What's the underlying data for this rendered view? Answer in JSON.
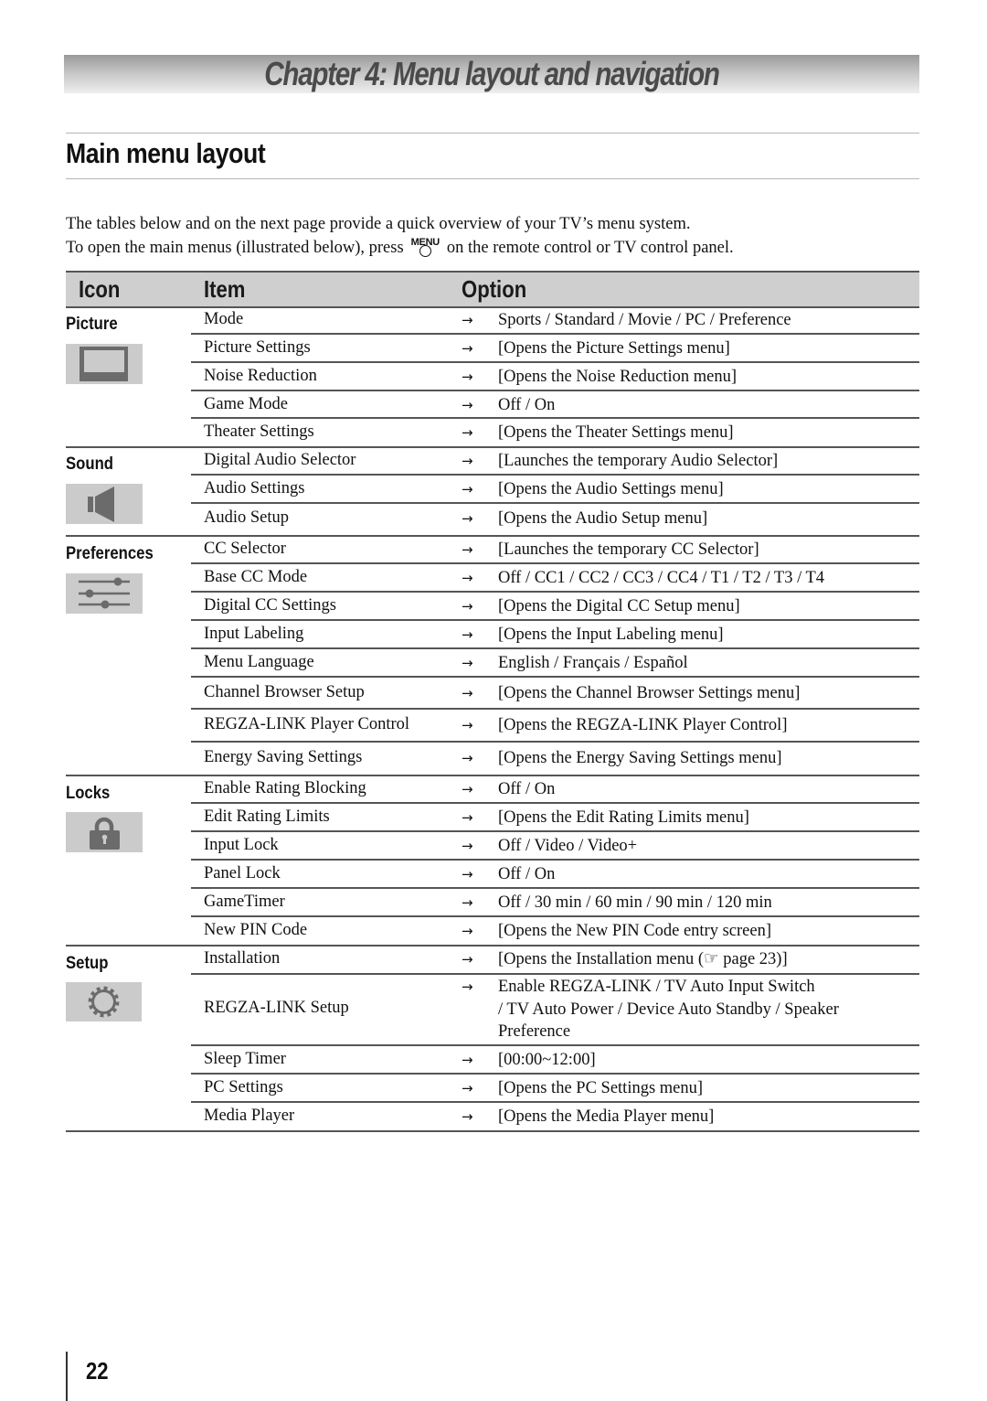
{
  "chapter": {
    "title": "Chapter 4: Menu layout and navigation"
  },
  "section": {
    "title": "Main menu layout"
  },
  "intro": {
    "line1": "The tables below and on the next page provide a quick overview of your TV’s menu system.",
    "line2_before": "To open the main menus (illustrated below), press",
    "menu_button_label": "MENU",
    "line2_after": "on the remote control or TV control panel."
  },
  "table": {
    "headers": {
      "icon": "Icon",
      "item": "Item",
      "option": "Option"
    },
    "arrow": "→",
    "sections": [
      {
        "label": "Picture",
        "icon": "tv-screen-icon",
        "rows": [
          {
            "item": "Mode",
            "option": "Sports / Standard / Movie / PC / Preference"
          },
          {
            "item": "Picture Settings",
            "option": "[Opens the Picture Settings menu]"
          },
          {
            "item": "Noise Reduction",
            "option": "[Opens the Noise Reduction menu]"
          },
          {
            "item": "Game Mode",
            "option": "Off / On"
          },
          {
            "item": "Theater Settings",
            "option": "[Opens the Theater Settings menu]"
          }
        ]
      },
      {
        "label": "Sound",
        "icon": "speaker-icon",
        "rows": [
          {
            "item": "Digital Audio Selector",
            "option": "[Launches the temporary Audio Selector]"
          },
          {
            "item": "Audio Settings",
            "option": "[Opens the Audio Settings menu]"
          },
          {
            "item": "Audio Setup",
            "option": "[Opens the Audio Setup menu]"
          }
        ]
      },
      {
        "label": "Preferences",
        "icon": "sliders-icon",
        "rows": [
          {
            "item": "CC Selector",
            "option": "[Launches the temporary CC Selector]"
          },
          {
            "item": "Base CC Mode",
            "option": "Off / CC1 / CC2 / CC3 / CC4 / T1 / T2 / T3 / T4"
          },
          {
            "item": "Digital CC Settings",
            "option": "[Opens the Digital CC Setup menu]"
          },
          {
            "item": "Input Labeling",
            "option": "[Opens the Input Labeling menu]"
          },
          {
            "item": "Menu Language",
            "option": "English / Français / Español"
          },
          {
            "item": "Channel Browser Setup",
            "option": "[Opens the Channel Browser Settings menu]"
          },
          {
            "item": "REGZA-LINK Player Control",
            "option": "[Opens the REGZA-LINK Player Control]"
          },
          {
            "item": "Energy Saving Settings",
            "option": "[Opens the Energy Saving Settings menu]"
          }
        ]
      },
      {
        "label": "Locks",
        "icon": "padlock-icon",
        "rows": [
          {
            "item": "Enable Rating Blocking",
            "option": "Off / On"
          },
          {
            "item": "Edit Rating Limits",
            "option": "[Opens the Edit Rating Limits menu]"
          },
          {
            "item": "Input Lock",
            "option": "Off / Video / Video+"
          },
          {
            "item": "Panel Lock",
            "option": "Off / On"
          },
          {
            "item": "GameTimer",
            "option": "Off / 30 min / 60 min / 90 min / 120 min"
          },
          {
            "item": "New PIN Code",
            "option": "[Opens the New PIN Code entry screen]"
          }
        ]
      },
      {
        "label": "Setup",
        "icon": "gear-icon",
        "rows": [
          {
            "item": "Installation",
            "option": "[Opens the Installation menu (☞ page 23)]"
          },
          {
            "item": "REGZA-LINK Setup",
            "option": "Enable REGZA-LINK / TV Auto Input Switch\n/ TV Auto Power / Device Auto Standby / Speaker\nPreference"
          },
          {
            "item": "Sleep Timer",
            "option": "[00:00~12:00]"
          },
          {
            "item": "PC Settings",
            "option": "[Opens the PC Settings menu]"
          },
          {
            "item": "Media Player",
            "option": "[Opens the Media Player menu]"
          }
        ]
      }
    ]
  },
  "footer": {
    "page_number": "22"
  }
}
